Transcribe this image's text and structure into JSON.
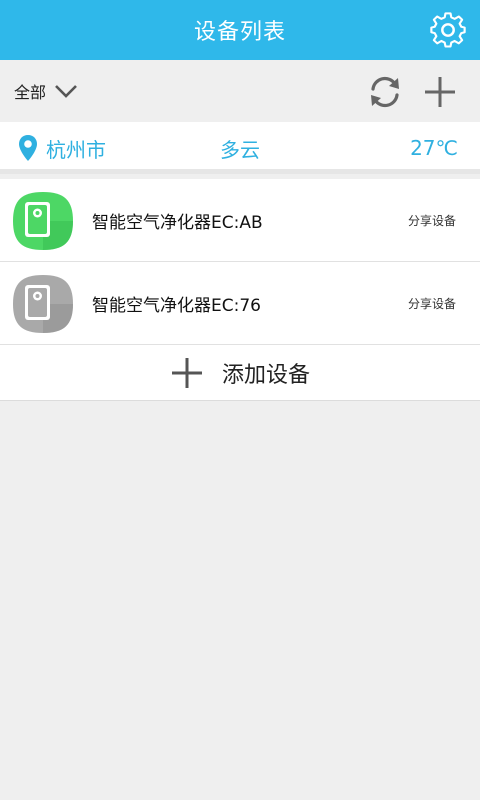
{
  "header": {
    "title": "设备列表",
    "settings_icon": "gear-icon"
  },
  "toolbar": {
    "filter_label": "全部",
    "filter_icon": "chevron-down-icon",
    "refresh_icon": "refresh-icon",
    "add_icon": "plus-icon"
  },
  "weather": {
    "city": "杭州市",
    "condition": "多云",
    "temperature": "27℃",
    "location_icon": "location-pin-icon"
  },
  "devices": [
    {
      "name": "智能空气净化器EC:AB",
      "action": "分享设备",
      "status": "online",
      "color": "#4dd765"
    },
    {
      "name": "智能空气净化器EC:76",
      "action": "分享设备",
      "status": "offline",
      "color": "#a9a9a9"
    }
  ],
  "add_device": {
    "label": "添加设备",
    "icon": "plus-icon"
  },
  "colors": {
    "primary": "#2fb8ea",
    "accent_text": "#2fb0e0",
    "background": "#efefef"
  }
}
